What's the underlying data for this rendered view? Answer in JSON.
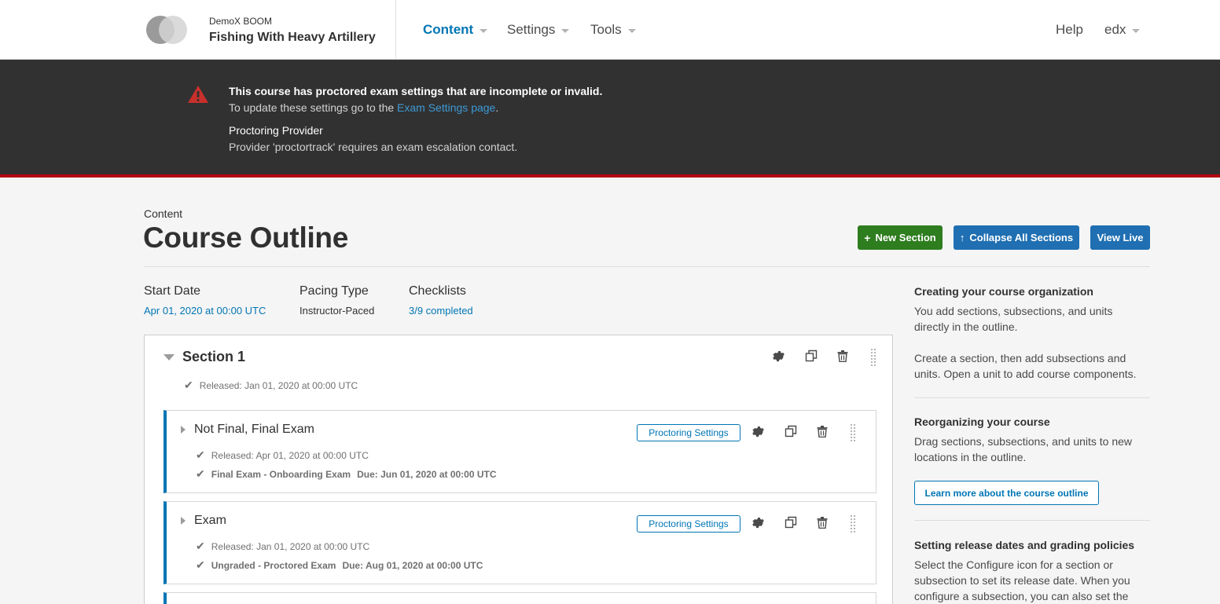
{
  "header": {
    "course_org": "DemoX  BOOM",
    "course_title": "Fishing With Heavy Artillery",
    "nav": [
      {
        "label": "Content"
      },
      {
        "label": "Settings"
      },
      {
        "label": "Tools"
      }
    ],
    "help_label": "Help",
    "user_label": "edx"
  },
  "alert": {
    "title": "This course has proctored exam settings that are incomplete or invalid.",
    "line_prefix": "To update these settings go to the ",
    "link_text": "Exam Settings page",
    "line_suffix": ".",
    "sub_title": "Proctoring Provider",
    "sub_text": "Provider 'proctortrack' requires an exam escalation contact."
  },
  "page": {
    "breadcrumb": "Content",
    "title": "Course Outline",
    "new_section_label": "New Section",
    "collapse_label": "Collapse All Sections",
    "view_live_label": "View Live"
  },
  "meta": {
    "start_date_label": "Start Date",
    "start_date_value": "Apr 01, 2020 at 00:00 UTC",
    "pacing_label": "Pacing Type",
    "pacing_value": "Instructor-Paced",
    "checklists_label": "Checklists",
    "checklists_value": "3/9 completed"
  },
  "outline": {
    "section": {
      "title": "Section 1",
      "status": "Released: Jan 01, 2020 at 00:00 UTC"
    },
    "subsections": [
      {
        "title": "Not Final, Final Exam",
        "released": "Released: Apr 01, 2020 at 00:00 UTC",
        "exam_type": "Final Exam - Onboarding Exam",
        "due": "Due: Jun 01, 2020 at 00:00 UTC",
        "proctoring_label": "Proctoring Settings"
      },
      {
        "title": "Exam",
        "released": "Released: Jan 01, 2020 at 00:00 UTC",
        "exam_type": "Ungraded - Proctored Exam",
        "due": "Due: Aug 01, 2020 at 00:00 UTC",
        "proctoring_label": "Proctoring Settings"
      }
    ]
  },
  "sidebar": {
    "block1_title": "Creating your course organization",
    "block1_p1": "You add sections, subsections, and units directly in the outline.",
    "block1_p2": "Create a section, then add subsections and units. Open a unit to add course components.",
    "block2_title": "Reorganizing your course",
    "block2_p1": "Drag sections, subsections, and units to new locations in the outline.",
    "block2_button": "Learn more about the course outline",
    "block3_title": "Setting release dates and grading policies",
    "block3_p1": "Select the Configure icon for a section or subsection to set its release date. When you configure a subsection, you can also set the"
  },
  "colors": {
    "accent_blue": "#0075b4",
    "green_button": "#2e7d1f",
    "alert_bg": "#313131",
    "alert_border": "#b20610",
    "alert_icon": "#c9302c"
  }
}
